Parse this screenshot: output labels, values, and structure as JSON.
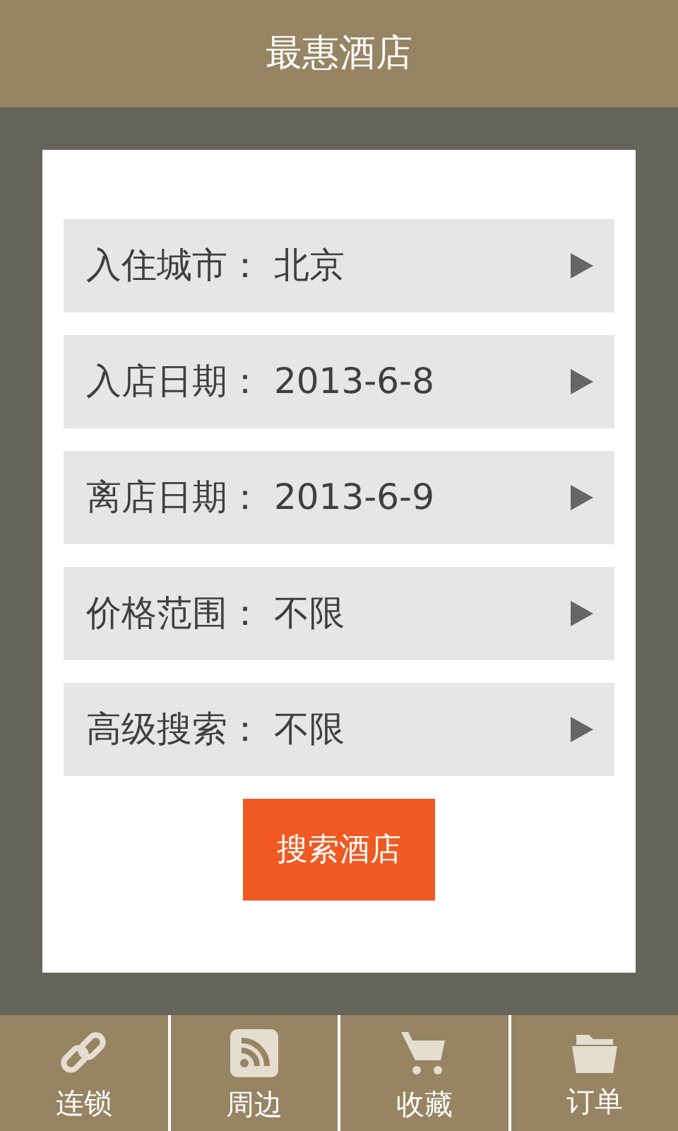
{
  "header": {
    "title": "最惠酒店"
  },
  "fields": [
    {
      "label": "入住城市：",
      "value": "北京"
    },
    {
      "label": "入店日期：",
      "value": "2013-6-8"
    },
    {
      "label": "离店日期：",
      "value": "2013-6-9"
    },
    {
      "label": "价格范围：",
      "value": "不限"
    },
    {
      "label": "高级搜索：",
      "value": "不限"
    }
  ],
  "search_button": "搜索酒店",
  "tabs": [
    {
      "label": "连锁",
      "kind": "link"
    },
    {
      "label": "周边",
      "kind": "rss"
    },
    {
      "label": "收藏",
      "kind": "cart"
    },
    {
      "label": "订单",
      "kind": "folder"
    }
  ]
}
